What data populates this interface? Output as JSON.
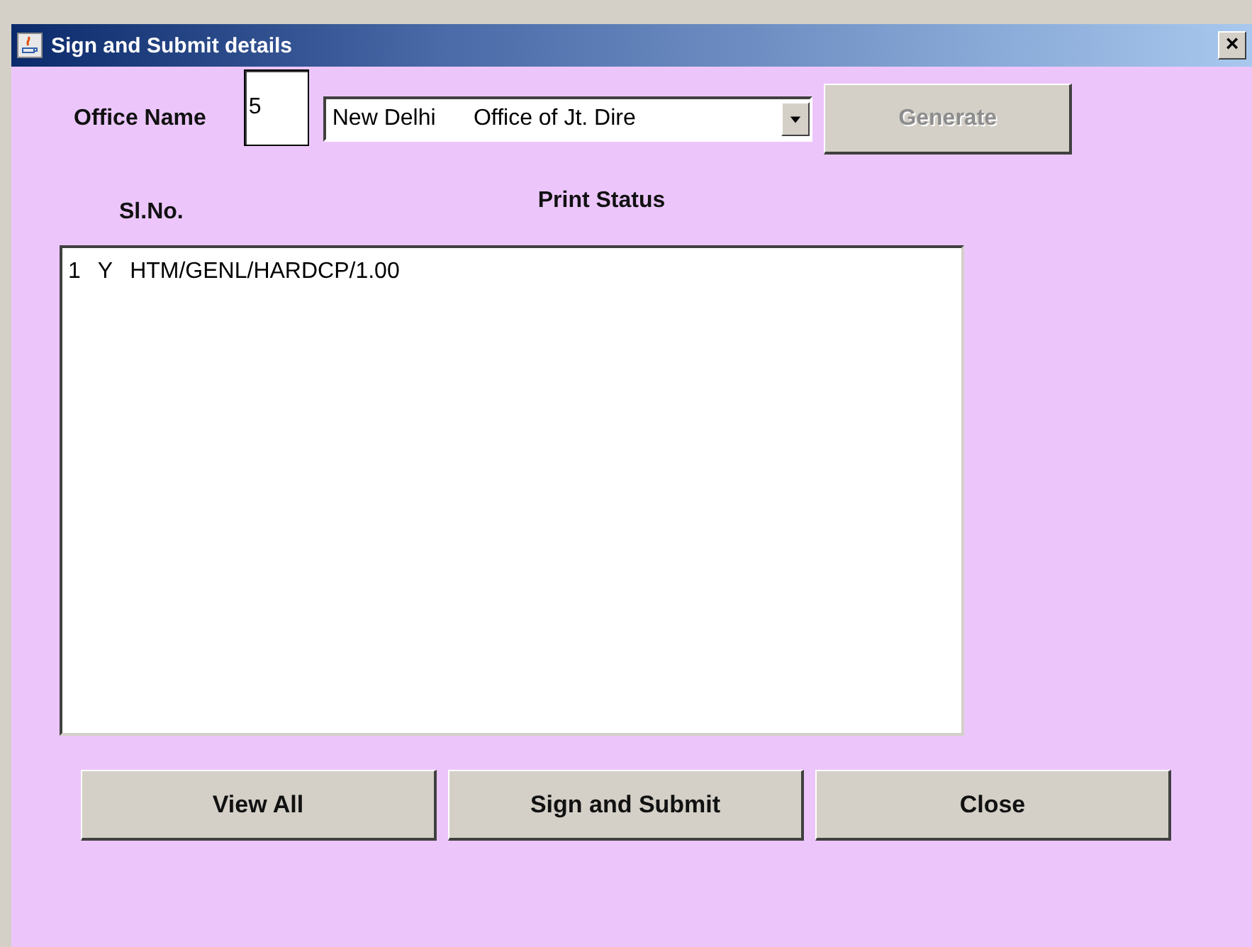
{
  "window": {
    "title": "Sign and Submit details",
    "close": "×"
  },
  "office": {
    "label": "Office Name",
    "code": "5",
    "selection": "New Delhi      Office of Jt. Dire",
    "generate": {
      "label": "Generate",
      "disabled": true
    }
  },
  "list": {
    "headers": [
      "Sl.No.",
      "Print Status"
    ],
    "rows": [
      {
        "sl": "1",
        "status": "Y",
        "text": "HTM/GENL/HARDCP/1.00"
      }
    ]
  },
  "buttons": [
    {
      "label": "View All"
    },
    {
      "label": "Sign and Submit"
    },
    {
      "label": "Close"
    }
  ]
}
